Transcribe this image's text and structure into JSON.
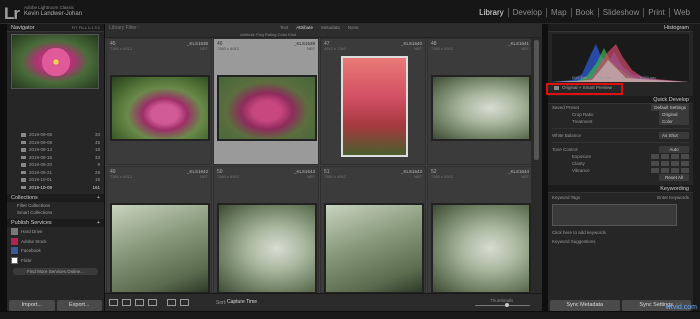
{
  "app": {
    "logo": "Lr",
    "title": "Adobe Lightroom Classic",
    "user": "Kevin Landwer-Johan"
  },
  "modules": [
    "Library",
    "Develop",
    "Map",
    "Book",
    "Slideshow",
    "Print",
    "Web"
  ],
  "left": {
    "navigator_title": "Navigator",
    "navigator_zoom": "FIT  FILL  1:1  3:1",
    "folders": [
      {
        "name": "2019-09-06",
        "count": "33"
      },
      {
        "name": "2019-09-09",
        "count": "45"
      },
      {
        "name": "2019-09-14",
        "count": "18"
      },
      {
        "name": "2019-09-16",
        "count": "33"
      },
      {
        "name": "2019-09-20",
        "count": "9"
      },
      {
        "name": "2019-09-21",
        "count": "29"
      },
      {
        "name": "2019-10-01",
        "count": "15"
      },
      {
        "name": "2019-10-09",
        "count": "161"
      }
    ],
    "collections_title": "Collections",
    "filter_collections": "Filter Collections",
    "smart_collections": "Smart Collections",
    "publish_title": "Publish Services",
    "services": [
      {
        "name": "Hard Drive",
        "color": "#7a7a7a"
      },
      {
        "name": "Adobe Stock",
        "color": "#b0264e"
      },
      {
        "name": "Facebook",
        "color": "#3b5998"
      },
      {
        "name": "Flickr",
        "color": "#ffffff"
      }
    ],
    "find_more": "Find More Services Online...",
    "import_label": "Import...",
    "export_label": "Export..."
  },
  "center": {
    "filter_title": "Library Filter :",
    "filter_tabs": [
      "Text",
      "Attribute",
      "Metadata",
      "None"
    ],
    "filter_row": "Attribute  Flag  Rating  Color  Kind",
    "cells": [
      {
        "idx": "45",
        "file": "_KLS1638",
        "dims": "7360 x 4912",
        "ext": "NEF"
      },
      {
        "idx": "46",
        "file": "_KLS1639",
        "dims": "7360 x 4912",
        "ext": "NEF"
      },
      {
        "idx": "47",
        "file": "_KLS1640",
        "dims": "4912 x 7360",
        "ext": "NEF"
      },
      {
        "idx": "48",
        "file": "_KLS1641",
        "dims": "7360 x 4912",
        "ext": "NEF"
      },
      {
        "idx": "49",
        "file": "_KLS1642",
        "dims": "7360 x 4912",
        "ext": "NEF"
      },
      {
        "idx": "50",
        "file": "_KLS1643",
        "dims": "7360 x 4912",
        "ext": "NEF"
      },
      {
        "idx": "51",
        "file": "_KLS1643",
        "dims": "7360 x 4912",
        "ext": "NEF"
      },
      {
        "idx": "52",
        "file": "_KLS1644",
        "dims": "7360 x 4912",
        "ext": "NEF"
      }
    ],
    "sort_label": "Sort:",
    "sort_value": "Capture Time",
    "thumbnails_label": "Thumbnails"
  },
  "right": {
    "histogram_title": "Histogram",
    "histo_info": [
      "ISO 400",
      "105 mm",
      "f/4.0",
      "1/250 sec"
    ],
    "original_label": "Original + Smart Preview",
    "quick_develop_title": "Quick Develop",
    "saved_preset": "Saved Preset",
    "saved_preset_value": "Default Settings",
    "crop_label": "Crop Ratio",
    "crop_value": "Original",
    "treatment_label": "Treatment",
    "treatment_value": "Color",
    "wb_label": "White Balance",
    "wb_value": "As Shot",
    "tone_label": "Tone Control",
    "auto_label": "Auto",
    "exposure_label": "Exposure",
    "clarity_label": "Clarity",
    "vibrance_label": "Vibrance",
    "reset_label": "Reset All",
    "keywording_title": "Keywording",
    "keyword_tags": "Keyword Tags",
    "keyword_tags_value": "Enter Keywords",
    "click_add": "Click here to add keywords",
    "keyword_suggestions": "Keyword Suggestions",
    "sync_metadata": "Sync Metadata",
    "sync_settings": "Sync Settings"
  },
  "watermark": "wtvid.com"
}
